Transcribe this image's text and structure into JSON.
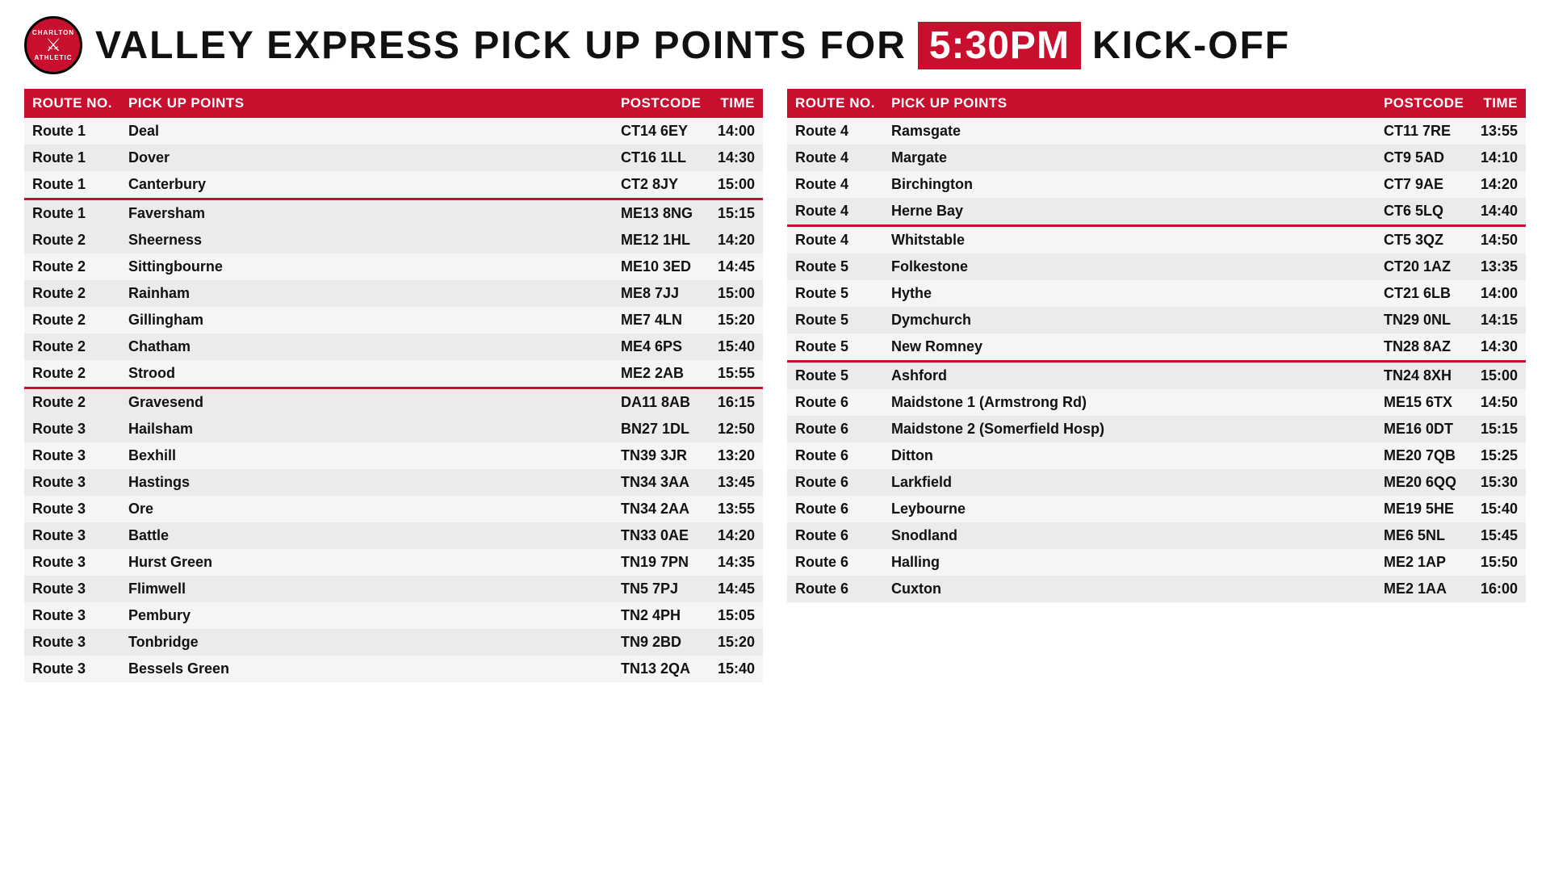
{
  "header": {
    "title_before": "VALLEY EXPRESS PICK UP POINTS FOR",
    "kickoff_time": "5:30PM",
    "title_after": "KICK-OFF"
  },
  "table_headers": {
    "route_no": "ROUTE NO.",
    "pick_up_points": "PICK UP POINTS",
    "postcode": "POSTCODE",
    "time": "TIME"
  },
  "left_table": [
    {
      "route": "Route 1",
      "pickup": "Deal",
      "postcode": "CT14 6EY",
      "time": "14:00",
      "separator": false
    },
    {
      "route": "Route 1",
      "pickup": "Dover",
      "postcode": "CT16 1LL",
      "time": "14:30",
      "separator": false
    },
    {
      "route": "Route 1",
      "pickup": "Canterbury",
      "postcode": "CT2 8JY",
      "time": "15:00",
      "separator": false
    },
    {
      "route": "Route 1",
      "pickup": "Faversham",
      "postcode": "ME13 8NG",
      "time": "15:15",
      "separator": true
    },
    {
      "route": "Route 2",
      "pickup": "Sheerness",
      "postcode": "ME12 1HL",
      "time": "14:20",
      "separator": false
    },
    {
      "route": "Route 2",
      "pickup": "Sittingbourne",
      "postcode": "ME10 3ED",
      "time": "14:45",
      "separator": false
    },
    {
      "route": "Route 2",
      "pickup": "Rainham",
      "postcode": "ME8 7JJ",
      "time": "15:00",
      "separator": false
    },
    {
      "route": "Route 2",
      "pickup": "Gillingham",
      "postcode": "ME7 4LN",
      "time": "15:20",
      "separator": false
    },
    {
      "route": "Route 2",
      "pickup": "Chatham",
      "postcode": "ME4 6PS",
      "time": "15:40",
      "separator": false
    },
    {
      "route": "Route 2",
      "pickup": "Strood",
      "postcode": "ME2 2AB",
      "time": "15:55",
      "separator": false
    },
    {
      "route": "Route 2",
      "pickup": "Gravesend",
      "postcode": "DA11 8AB",
      "time": "16:15",
      "separator": true
    },
    {
      "route": "Route 3",
      "pickup": "Hailsham",
      "postcode": "BN27 1DL",
      "time": "12:50",
      "separator": false
    },
    {
      "route": "Route 3",
      "pickup": "Bexhill",
      "postcode": "TN39 3JR",
      "time": "13:20",
      "separator": false
    },
    {
      "route": "Route 3",
      "pickup": "Hastings",
      "postcode": "TN34 3AA",
      "time": "13:45",
      "separator": false
    },
    {
      "route": "Route 3",
      "pickup": "Ore",
      "postcode": "TN34 2AA",
      "time": "13:55",
      "separator": false
    },
    {
      "route": "Route 3",
      "pickup": "Battle",
      "postcode": "TN33 0AE",
      "time": "14:20",
      "separator": false
    },
    {
      "route": "Route 3",
      "pickup": "Hurst Green",
      "postcode": "TN19 7PN",
      "time": "14:35",
      "separator": false
    },
    {
      "route": "Route 3",
      "pickup": "Flimwell",
      "postcode": "TN5 7PJ",
      "time": "14:45",
      "separator": false
    },
    {
      "route": "Route 3",
      "pickup": "Pembury",
      "postcode": "TN2 4PH",
      "time": "15:05",
      "separator": false
    },
    {
      "route": "Route 3",
      "pickup": "Tonbridge",
      "postcode": "TN9 2BD",
      "time": "15:20",
      "separator": false
    },
    {
      "route": "Route 3",
      "pickup": "Bessels Green",
      "postcode": "TN13 2QA",
      "time": "15:40",
      "separator": false
    }
  ],
  "right_table": [
    {
      "route": "Route 4",
      "pickup": "Ramsgate",
      "postcode": "CT11 7RE",
      "time": "13:55",
      "separator": false
    },
    {
      "route": "Route 4",
      "pickup": "Margate",
      "postcode": "CT9 5AD",
      "time": "14:10",
      "separator": false
    },
    {
      "route": "Route 4",
      "pickup": "Birchington",
      "postcode": "CT7 9AE",
      "time": "14:20",
      "separator": false
    },
    {
      "route": "Route 4",
      "pickup": "Herne Bay",
      "postcode": "CT6 5LQ",
      "time": "14:40",
      "separator": false
    },
    {
      "route": "Route 4",
      "pickup": "Whitstable",
      "postcode": "CT5 3QZ",
      "time": "14:50",
      "separator": true
    },
    {
      "route": "Route 5",
      "pickup": "Folkestone",
      "postcode": "CT20 1AZ",
      "time": "13:35",
      "separator": false
    },
    {
      "route": "Route 5",
      "pickup": "Hythe",
      "postcode": "CT21 6LB",
      "time": "14:00",
      "separator": false
    },
    {
      "route": "Route 5",
      "pickup": "Dymchurch",
      "postcode": "TN29 0NL",
      "time": "14:15",
      "separator": false
    },
    {
      "route": "Route 5",
      "pickup": "New Romney",
      "postcode": "TN28 8AZ",
      "time": "14:30",
      "separator": false
    },
    {
      "route": "Route 5",
      "pickup": "Ashford",
      "postcode": "TN24 8XH",
      "time": "15:00",
      "separator": true
    },
    {
      "route": "Route 6",
      "pickup": "Maidstone 1 (Armstrong Rd)",
      "postcode": "ME15 6TX",
      "time": "14:50",
      "separator": false
    },
    {
      "route": "Route 6",
      "pickup": "Maidstone 2 (Somerfield Hosp)",
      "postcode": "ME16 0DT",
      "time": "15:15",
      "separator": false
    },
    {
      "route": "Route 6",
      "pickup": "Ditton",
      "postcode": "ME20 7QB",
      "time": "15:25",
      "separator": false
    },
    {
      "route": "Route 6",
      "pickup": "Larkfield",
      "postcode": "ME20 6QQ",
      "time": "15:30",
      "separator": false
    },
    {
      "route": "Route 6",
      "pickup": "Leybourne",
      "postcode": "ME19 5HE",
      "time": "15:40",
      "separator": false
    },
    {
      "route": "Route 6",
      "pickup": "Snodland",
      "postcode": "ME6 5NL",
      "time": "15:45",
      "separator": false
    },
    {
      "route": "Route 6",
      "pickup": "Halling",
      "postcode": "ME2 1AP",
      "time": "15:50",
      "separator": false
    },
    {
      "route": "Route 6",
      "pickup": "Cuxton",
      "postcode": "ME2 1AA",
      "time": "16:00",
      "separator": false
    }
  ]
}
